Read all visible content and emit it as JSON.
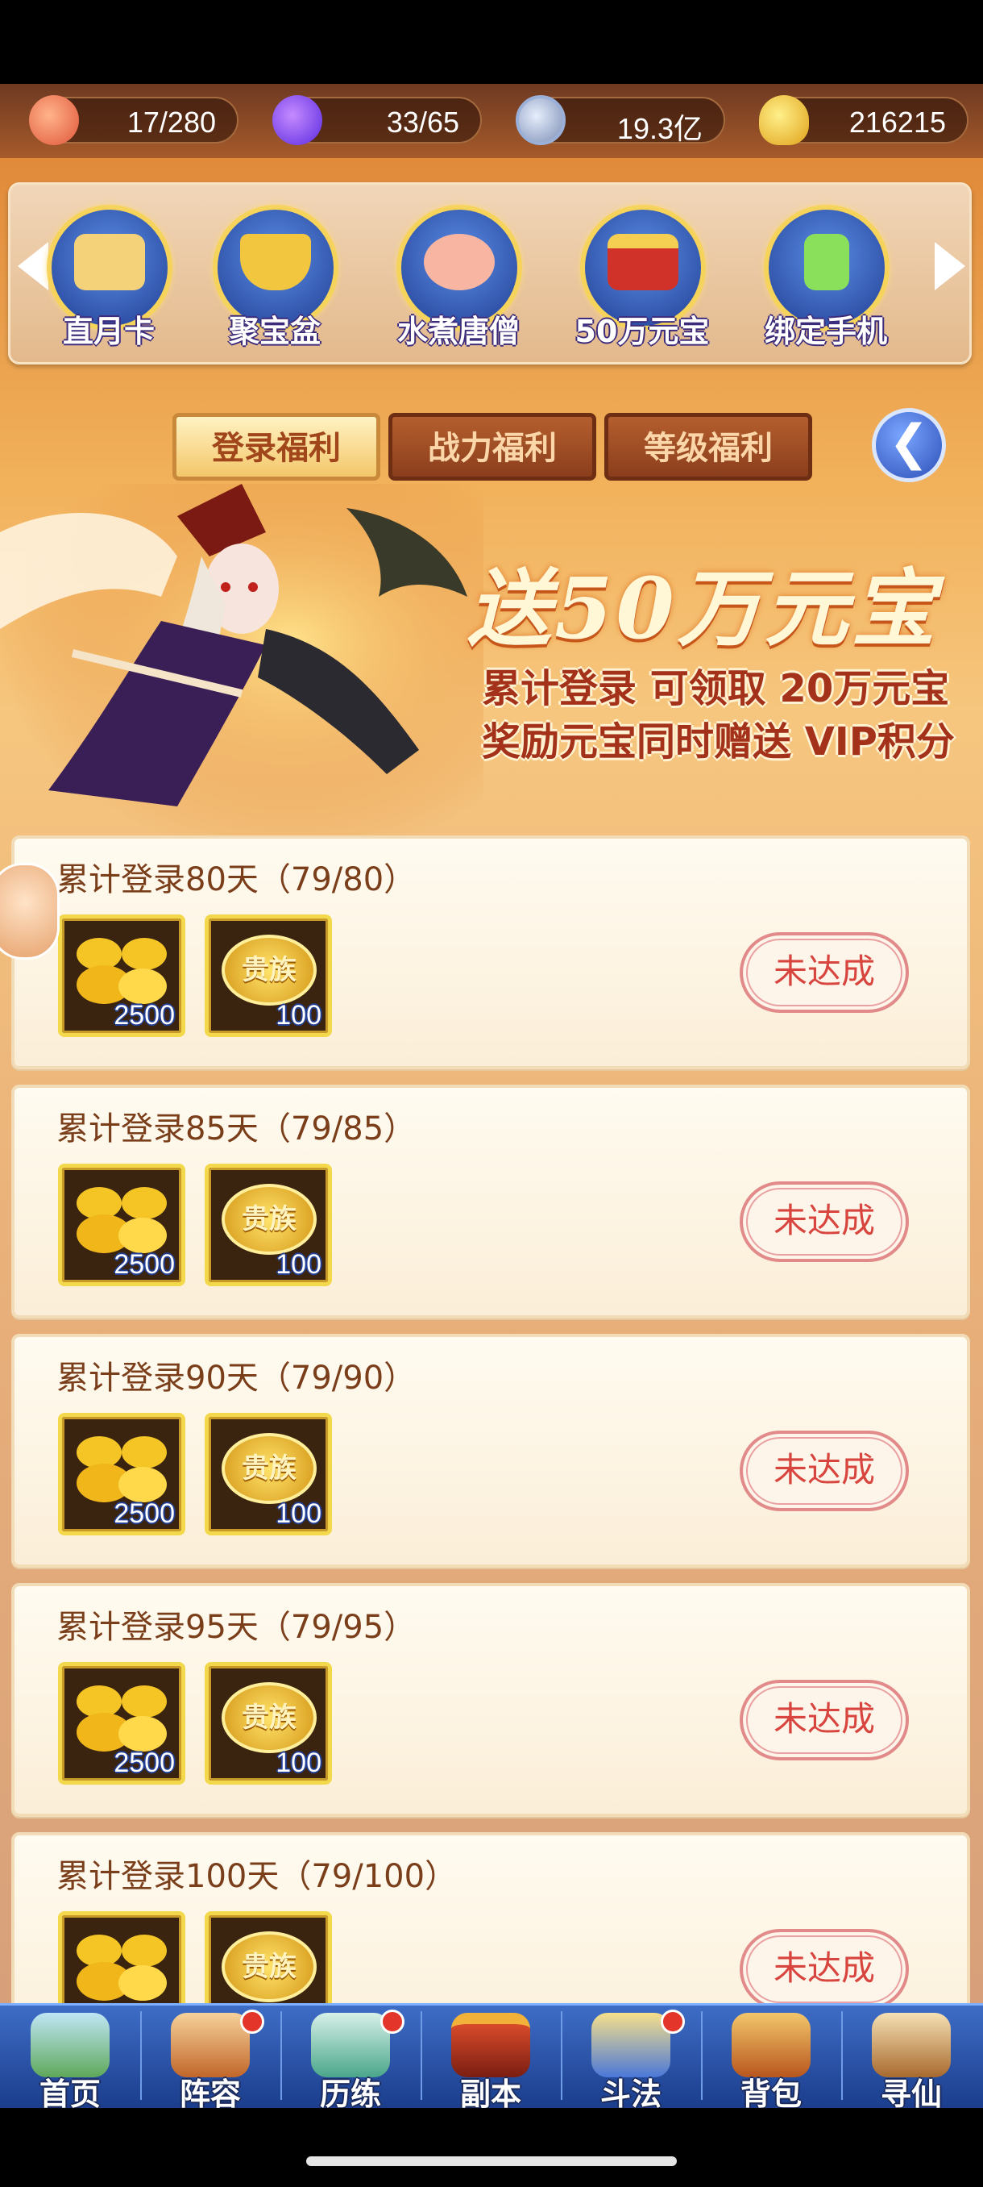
{
  "resources": [
    {
      "icon": "peach-icon",
      "value": "17/280"
    },
    {
      "icon": "flame-icon",
      "value": "33/65"
    },
    {
      "icon": "coin-icon",
      "value": "19.3亿"
    },
    {
      "icon": "gold-ingot-icon",
      "value": "216215"
    }
  ],
  "activities": [
    {
      "label": "直月卡",
      "icon": "month-card-icon"
    },
    {
      "label": "聚宝盆",
      "icon": "treasure-bowl-icon"
    },
    {
      "label": "水煮唐僧",
      "icon": "monk-icon"
    },
    {
      "label": "50万元宝",
      "icon": "gift-box-icon"
    },
    {
      "label": "绑定手机",
      "icon": "phone-icon"
    }
  ],
  "tabs": [
    {
      "label": "登录福利",
      "active": true
    },
    {
      "label": "战力福利",
      "active": false
    },
    {
      "label": "等级福利",
      "active": false
    }
  ],
  "back_icon": "back-arrow-icon",
  "banner": {
    "headline": "送50万元宝",
    "line1": "累计登录 可领取 20万元宝",
    "line2": "奖励元宝同时赠送 VIP积分"
  },
  "rewards": [
    {
      "title": "累计登录80天（79/80）",
      "items": [
        {
          "icon": "gold-ingot-icon",
          "qty": "2500"
        },
        {
          "icon": "noble-token-icon",
          "label": "贵族",
          "qty": "100"
        }
      ],
      "button": "未达成"
    },
    {
      "title": "累计登录85天（79/85）",
      "items": [
        {
          "icon": "gold-ingot-icon",
          "qty": "2500"
        },
        {
          "icon": "noble-token-icon",
          "label": "贵族",
          "qty": "100"
        }
      ],
      "button": "未达成"
    },
    {
      "title": "累计登录90天（79/90）",
      "items": [
        {
          "icon": "gold-ingot-icon",
          "qty": "2500"
        },
        {
          "icon": "noble-token-icon",
          "label": "贵族",
          "qty": "100"
        }
      ],
      "button": "未达成"
    },
    {
      "title": "累计登录95天（79/95）",
      "items": [
        {
          "icon": "gold-ingot-icon",
          "qty": "2500"
        },
        {
          "icon": "noble-token-icon",
          "label": "贵族",
          "qty": "100"
        }
      ],
      "button": "未达成"
    },
    {
      "title": "累计登录100天（79/100）",
      "items": [
        {
          "icon": "gold-ingot-icon",
          "qty": ""
        },
        {
          "icon": "noble-token-icon",
          "label": "贵族",
          "qty": ""
        }
      ],
      "button": "未达成"
    }
  ],
  "nav": [
    {
      "label": "首页",
      "icon": "home-icon",
      "badge": false
    },
    {
      "label": "阵容",
      "icon": "lineup-icon",
      "badge": true
    },
    {
      "label": "历练",
      "icon": "training-icon",
      "badge": true
    },
    {
      "label": "副本",
      "icon": "dungeon-icon",
      "badge": false
    },
    {
      "label": "斗法",
      "icon": "battle-icon",
      "badge": true
    },
    {
      "label": "背包",
      "icon": "backpack-icon",
      "badge": false
    },
    {
      "label": "寻仙",
      "icon": "scroll-icon",
      "badge": false
    }
  ],
  "colors": {
    "accent_gold": "#f2d84a",
    "button_text": "#d8453e",
    "nav_bg": "#1b3d8c"
  }
}
